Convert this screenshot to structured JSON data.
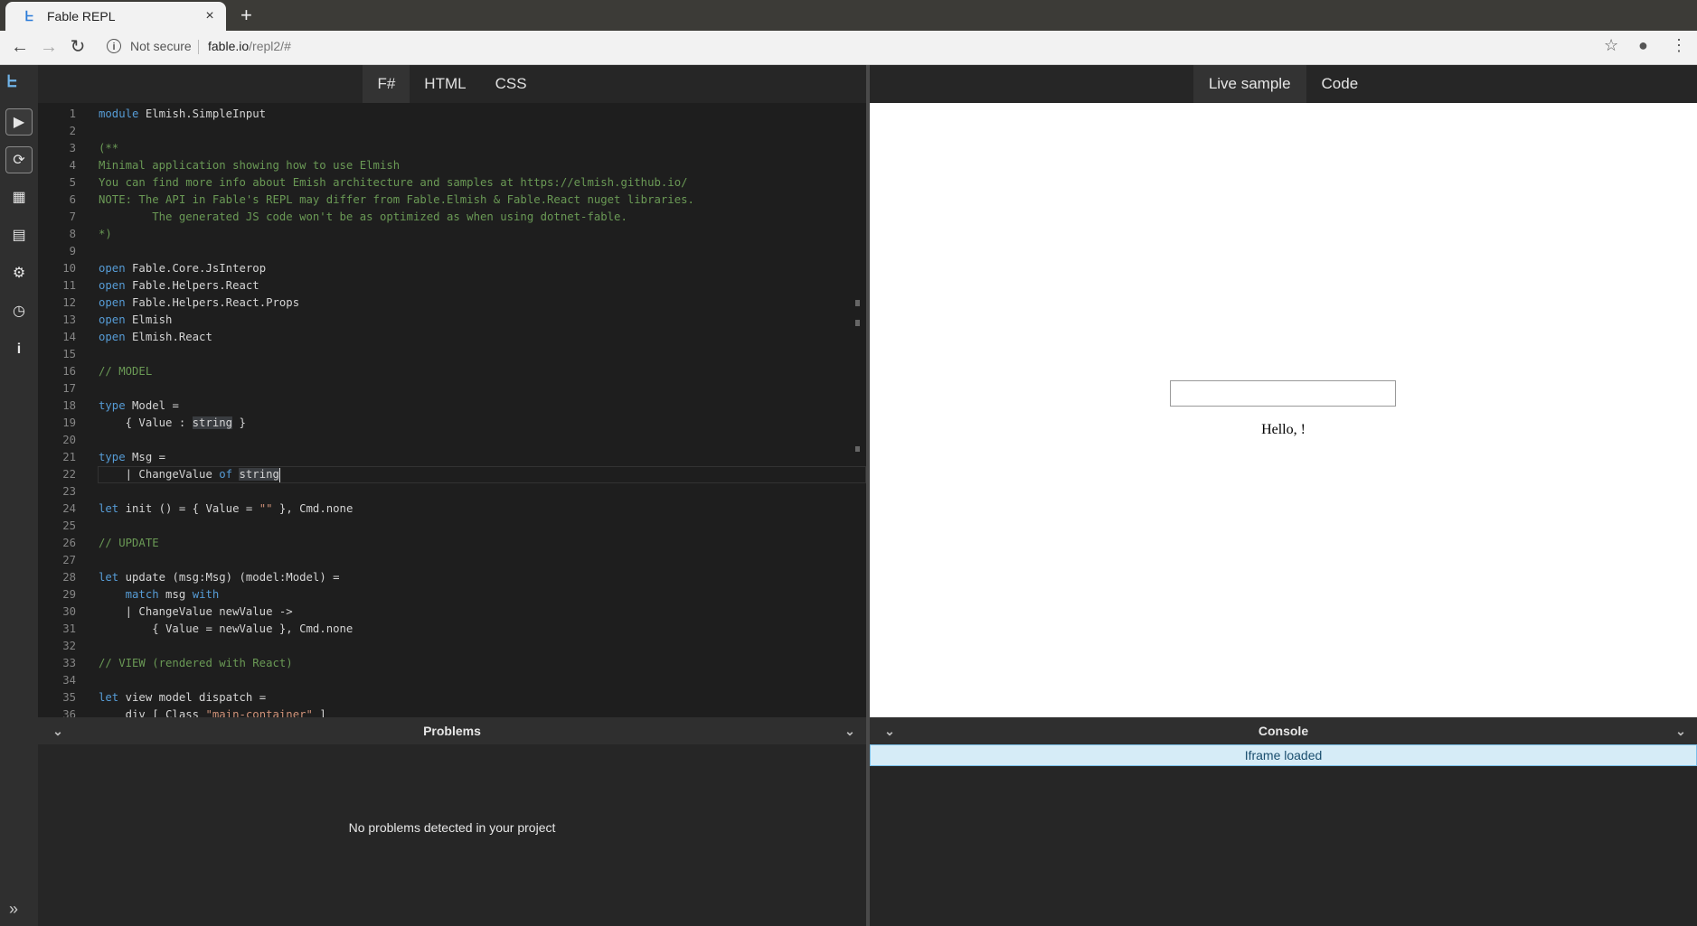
{
  "browser": {
    "tab_title": "Fable REPL",
    "tab_close": "×",
    "new_tab": "+",
    "security": "Not secure",
    "url_host": "fable.io",
    "url_path": "/repl2/#"
  },
  "sidebar": {
    "icons": [
      "run-icon",
      "refresh-icon",
      "apps-icon",
      "book-icon",
      "gear-icon",
      "history-icon",
      "info-icon"
    ],
    "expand": "»"
  },
  "editor": {
    "tabs": [
      "F#",
      "HTML",
      "CSS"
    ],
    "active_tab": "F#",
    "lines": [
      {
        "n": "1",
        "html": "<span class=\"kw\">module</span> Elmish.SimpleInput"
      },
      {
        "n": "2",
        "html": ""
      },
      {
        "n": "3",
        "html": "<span class=\"cm\">(**</span>"
      },
      {
        "n": "4",
        "html": "<span class=\"cm\">Minimal application showing how to use Elmish</span>"
      },
      {
        "n": "5",
        "html": "<span class=\"cm\">You can find more info about Emish architecture and samples at https://elmish.github.io/</span>"
      },
      {
        "n": "6",
        "html": "<span class=\"cm\">NOTE: The API in Fable's REPL may differ from Fable.Elmish &amp; Fable.React nuget libraries.</span>"
      },
      {
        "n": "7",
        "html": "<span class=\"cm\">        The generated JS code won't be as optimized as when using dotnet-fable.</span>"
      },
      {
        "n": "8",
        "html": "<span class=\"cm\">*)</span>"
      },
      {
        "n": "9",
        "html": ""
      },
      {
        "n": "10",
        "html": "<span class=\"kw\">open</span> Fable.Core.JsInterop"
      },
      {
        "n": "11",
        "html": "<span class=\"kw\">open</span> Fable.Helpers.React"
      },
      {
        "n": "12",
        "html": "<span class=\"kw\">open</span> Fable.Helpers.React.Props"
      },
      {
        "n": "13",
        "html": "<span class=\"kw\">open</span> Elmish"
      },
      {
        "n": "14",
        "html": "<span class=\"kw\">open</span> Elmish.React"
      },
      {
        "n": "15",
        "html": ""
      },
      {
        "n": "16",
        "html": "<span class=\"cm\">// MODEL</span>"
      },
      {
        "n": "17",
        "html": ""
      },
      {
        "n": "18",
        "html": "<span class=\"kw\">type</span> Model ="
      },
      {
        "n": "19",
        "html": "    { Value : <span class=\"hl\">string</span> }"
      },
      {
        "n": "20",
        "html": ""
      },
      {
        "n": "21",
        "html": "<span class=\"kw\">type</span> Msg ="
      },
      {
        "n": "22",
        "html": "    | ChangeValue <span class=\"kw\">of</span> <span class=\"hl\">string</span><span class=\"cursor\"></span>"
      },
      {
        "n": "23",
        "html": ""
      },
      {
        "n": "24",
        "html": "<span class=\"kw\">let</span> init () = { Value = <span class=\"st\">\"\"</span> }, Cmd.none"
      },
      {
        "n": "25",
        "html": ""
      },
      {
        "n": "26",
        "html": "<span class=\"cm\">// UPDATE</span>"
      },
      {
        "n": "27",
        "html": ""
      },
      {
        "n": "28",
        "html": "<span class=\"kw\">let</span> update (msg:Msg) (model:Model) ="
      },
      {
        "n": "29",
        "html": "    <span class=\"kw\">match</span> msg <span class=\"kw\">with</span>"
      },
      {
        "n": "30",
        "html": "    | ChangeValue newValue -&gt;"
      },
      {
        "n": "31",
        "html": "        { Value = newValue }, Cmd.none"
      },
      {
        "n": "32",
        "html": ""
      },
      {
        "n": "33",
        "html": "<span class=\"cm\">// VIEW (rendered with React)</span>"
      },
      {
        "n": "34",
        "html": ""
      },
      {
        "n": "35",
        "html": "<span class=\"kw\">let</span> view model dispatch ="
      },
      {
        "n": "36",
        "html": "    div [ Class <span class=\"st\">\"main-container\"</span> ]"
      }
    ],
    "current_line": "22"
  },
  "problems": {
    "title": "Problems",
    "message": "No problems detected in your project"
  },
  "preview": {
    "tabs": [
      "Live sample",
      "Code"
    ],
    "active_tab": "Live sample",
    "hello_text": "Hello, !",
    "input_value": ""
  },
  "console": {
    "title": "Console",
    "messages": [
      "Iframe loaded"
    ]
  }
}
